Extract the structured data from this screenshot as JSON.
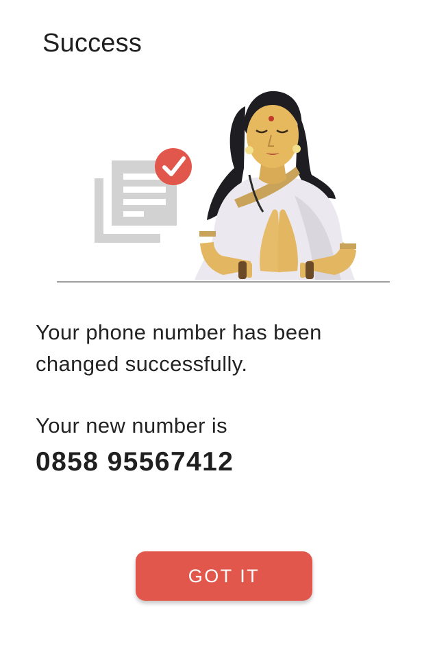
{
  "dialog": {
    "title": "Success",
    "message": "Your phone number has been changed successfully.",
    "new_number_label": "Your new number is",
    "new_number": "0858 95567412",
    "button_label": "GOT IT"
  },
  "illustration": {
    "icons": [
      "document-icon",
      "check-badge-icon"
    ],
    "figure": "woman-namaste-illustration"
  },
  "colors": {
    "accent": "#e2574c",
    "check_badge": "#e2574c",
    "document_gray": "#d2d2d2",
    "ground_line": "#9e9e9e"
  }
}
